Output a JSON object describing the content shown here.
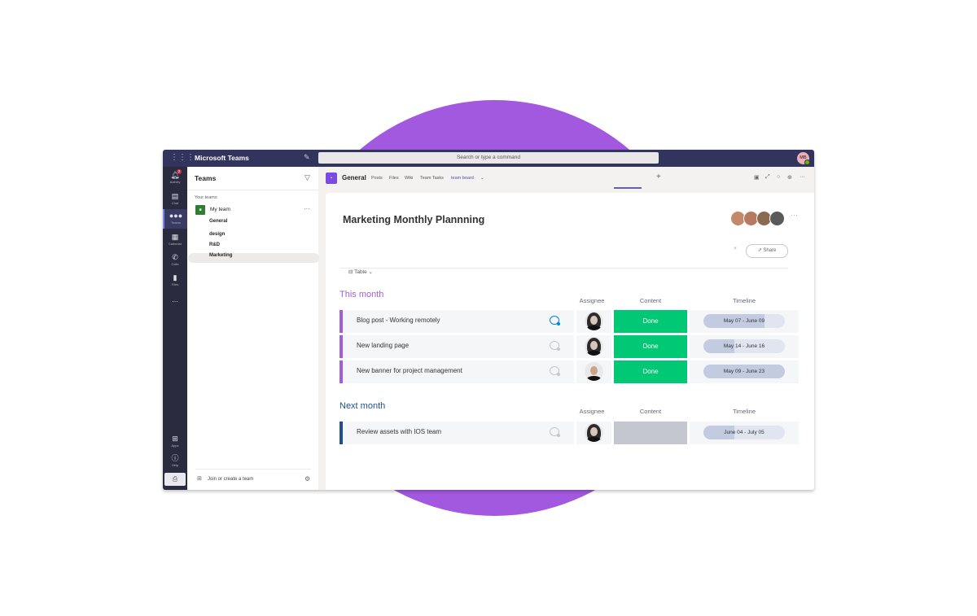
{
  "colors": {
    "accent_purple": "#a259df",
    "titlebar": "#33345e",
    "rail": "#2b2b40",
    "done_green": "#00c875",
    "this_month": "#a25ddc",
    "next_month": "#1f4f8f",
    "empty_status": "#c4c4c4"
  },
  "titlebar": {
    "app_title": "Microsoft Teams",
    "search_placeholder": "Search or type a command",
    "user_initials": "MB"
  },
  "rail": {
    "items": [
      {
        "label": "Activity",
        "icon": "bell-icon",
        "badge": "2"
      },
      {
        "label": "Chat",
        "icon": "chat-icon"
      },
      {
        "label": "Teams",
        "icon": "teams-icon",
        "active": true
      },
      {
        "label": "Calendar",
        "icon": "calendar-icon"
      },
      {
        "label": "Calls",
        "icon": "phone-icon"
      },
      {
        "label": "Files",
        "icon": "file-icon"
      },
      {
        "label": "...",
        "icon": "more-icon"
      }
    ],
    "bottom": [
      {
        "label": "Apps",
        "icon": "apps-icon"
      },
      {
        "label": "Help",
        "icon": "help-icon"
      }
    ]
  },
  "teams_panel": {
    "title": "Teams",
    "your_teams_label": "Your teams",
    "team": {
      "name": "My team",
      "icon_letter": "■"
    },
    "channels": [
      "General",
      "design",
      "R&D",
      "Marketing"
    ],
    "selected_channel": "Marketing",
    "join_label": "Join or create a team"
  },
  "channel_header": {
    "channel": "General",
    "tabs": [
      "Posts",
      "Files",
      "Wiki",
      "Team Tasks",
      "team board"
    ],
    "active_tab": "team board"
  },
  "board": {
    "title": "Marketing Monthly Plannning",
    "share_label": "Share",
    "view_label": "Table",
    "columns": {
      "assignee": "Assignee",
      "content": "Content",
      "timeline": "Timeline"
    },
    "groups": [
      {
        "title": "This month",
        "rows": [
          {
            "name": "Blog post - Working remotely",
            "status": "Done",
            "timeline": "May 07 - June 09",
            "progress": 0.75,
            "has_updates": true
          },
          {
            "name": "New landing page",
            "status": "Done",
            "timeline": "May 14 - June 16",
            "progress": 0.38,
            "has_updates": false
          },
          {
            "name": "New banner for project management",
            "status": "Done",
            "timeline": "May 09 - June 23",
            "progress": 1.0,
            "has_updates": false
          }
        ]
      },
      {
        "title": "Next month",
        "rows": [
          {
            "name": "Review assets with IOS team",
            "status": "",
            "timeline": "June 04 - July 05",
            "progress": 0.38,
            "has_updates": false
          }
        ]
      }
    ]
  }
}
